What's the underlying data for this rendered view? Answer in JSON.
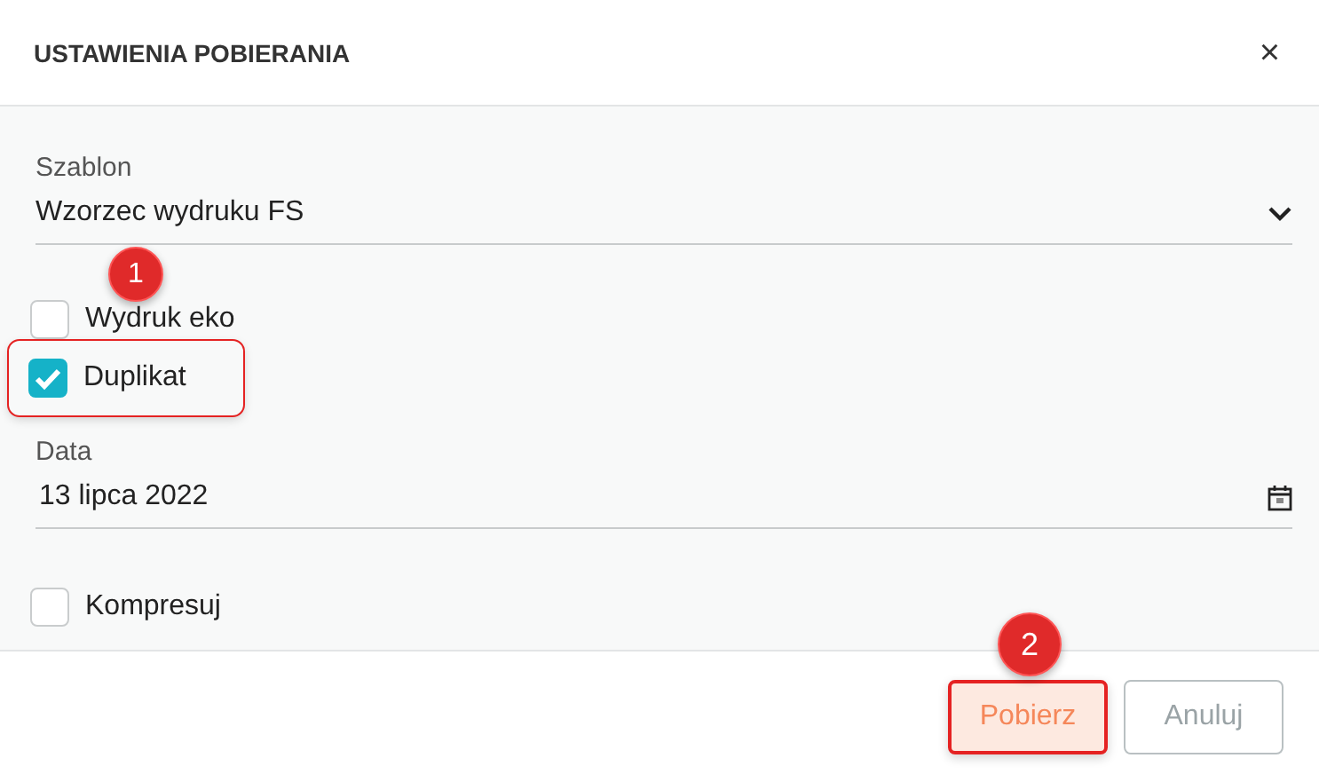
{
  "window": {
    "title": "USTAWIENIA POBIERANIA",
    "close": "×"
  },
  "fields": [
    {
      "kind": "select",
      "label": "Szablon",
      "value": "Wzorzec wydruku FS"
    },
    {
      "kind": "checkbox",
      "label": "Wydruk eko",
      "checked": false,
      "highlighted": false
    },
    {
      "kind": "checkbox",
      "label": "Duplikat",
      "checked": true,
      "highlighted": true,
      "badge": "1"
    },
    {
      "kind": "date",
      "label": "Data",
      "value": "13 lipca 2022"
    },
    {
      "kind": "checkbox",
      "label": "Kompresuj",
      "checked": false,
      "highlighted": false
    }
  ],
  "buttons": [
    {
      "label": "Pobierz",
      "kind": "primary",
      "highlighted": true,
      "badge": "2"
    },
    {
      "label": "Anuluj",
      "kind": "secondary",
      "highlighted": false
    }
  ]
}
